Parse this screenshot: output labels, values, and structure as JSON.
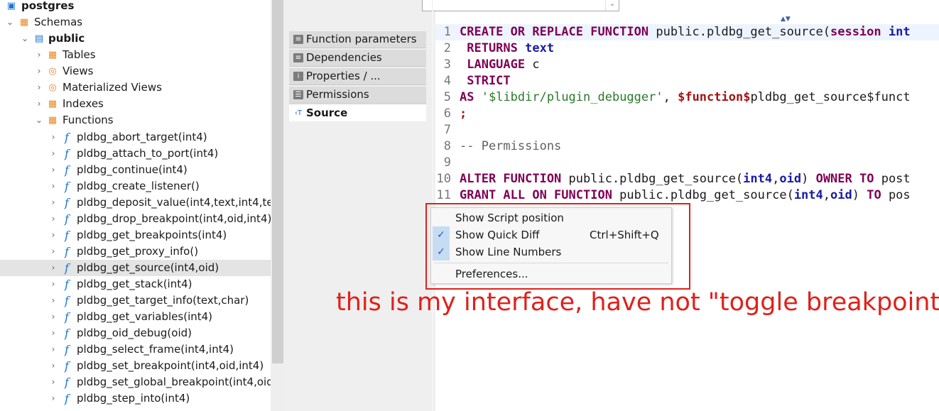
{
  "tree": {
    "db_label": "postgres",
    "schemas_label": "Schemas",
    "schema_label": "public",
    "folders": [
      "Tables",
      "Views",
      "Materialized Views",
      "Indexes",
      "Functions"
    ],
    "functions": [
      "pldbg_abort_target(int4)",
      "pldbg_attach_to_port(int4)",
      "pldbg_continue(int4)",
      "pldbg_create_listener()",
      "pldbg_deposit_value(int4,text,int4,tex",
      "pldbg_drop_breakpoint(int4,oid,int4)",
      "pldbg_get_breakpoints(int4)",
      "pldbg_get_proxy_info()",
      "pldbg_get_source(int4,oid)",
      "pldbg_get_stack(int4)",
      "pldbg_get_target_info(text,char)",
      "pldbg_get_variables(int4)",
      "pldbg_oid_debug(oid)",
      "pldbg_select_frame(int4,int4)",
      "pldbg_set_breakpoint(int4,oid,int4)",
      "pldbg_set_global_breakpoint(int4,oid",
      "pldbg_step_into(int4)"
    ],
    "selected_function": "pldbg_get_source(int4,oid)"
  },
  "tabs": [
    "Function parameters",
    "Dependencies",
    "Properties / ...",
    "Permissions",
    "Source"
  ],
  "active_tab": "Source",
  "editor": {
    "line_numbers": [
      "1",
      "2",
      "3",
      "4",
      "5",
      "6",
      "7",
      "8",
      "9",
      "10",
      "11"
    ],
    "lines": [
      [
        {
          "t": "CREATE OR REPLACE FUNCTION",
          "c": "kw"
        },
        {
          "t": " public.pldbg_get_source(",
          "c": "pl"
        },
        {
          "t": "session",
          "c": "kw"
        },
        {
          "t": " int",
          "c": "ty"
        }
      ],
      [
        {
          "t": " RETURNS",
          "c": "kw"
        },
        {
          "t": " text",
          "c": "ty"
        }
      ],
      [
        {
          "t": " LANGUAGE",
          "c": "kw"
        },
        {
          "t": " c",
          "c": "pl"
        }
      ],
      [
        {
          "t": " STRICT",
          "c": "kw"
        }
      ],
      [
        {
          "t": "AS",
          "c": "kw"
        },
        {
          "t": " ",
          "c": "pl"
        },
        {
          "t": "'$libdir/plugin_debugger'",
          "c": "st"
        },
        {
          "t": ", ",
          "c": "pl"
        },
        {
          "t": "$function$",
          "c": "dl"
        },
        {
          "t": "pldbg_get_source$funct",
          "c": "pl"
        }
      ],
      [
        {
          "t": ";",
          "c": "dl"
        }
      ],
      [],
      [
        {
          "t": "-- Permissions",
          "c": "cm"
        }
      ],
      [],
      [
        {
          "t": "ALTER FUNCTION",
          "c": "kw"
        },
        {
          "t": " public.pldbg_get_source(",
          "c": "pl"
        },
        {
          "t": "int4",
          "c": "ty"
        },
        {
          "t": ",",
          "c": "pl"
        },
        {
          "t": "oid",
          "c": "ty"
        },
        {
          "t": ") ",
          "c": "pl"
        },
        {
          "t": "OWNER TO",
          "c": "kw"
        },
        {
          "t": " post",
          "c": "pl"
        }
      ],
      [
        {
          "t": "GRANT ALL ON FUNCTION",
          "c": "kw"
        },
        {
          "t": " public.pldbg_get_source(",
          "c": "pl"
        },
        {
          "t": "int4",
          "c": "ty"
        },
        {
          "t": ",",
          "c": "pl"
        },
        {
          "t": "oid",
          "c": "ty"
        },
        {
          "t": ") ",
          "c": "pl"
        },
        {
          "t": "TO",
          "c": "kw"
        },
        {
          "t": " pos",
          "c": "pl"
        }
      ]
    ]
  },
  "context_menu": {
    "items": [
      {
        "label": "Show Script position",
        "checked": false,
        "shortcut": ""
      },
      {
        "label": "Show Quick Diff",
        "checked": true,
        "shortcut": "Ctrl+Shift+Q"
      },
      {
        "label": "Show Line Numbers",
        "checked": true,
        "shortcut": ""
      },
      {
        "label": "Preferences...",
        "checked": false,
        "shortcut": ""
      }
    ]
  },
  "annotation": "this is my interface, have not \"toggle breakpoint\"",
  "colors": {
    "annotation_red": "#e0201b",
    "check_bg": "#c5dcf3",
    "function_icon": "#1976d2",
    "folder_icon": "#e8871e"
  }
}
